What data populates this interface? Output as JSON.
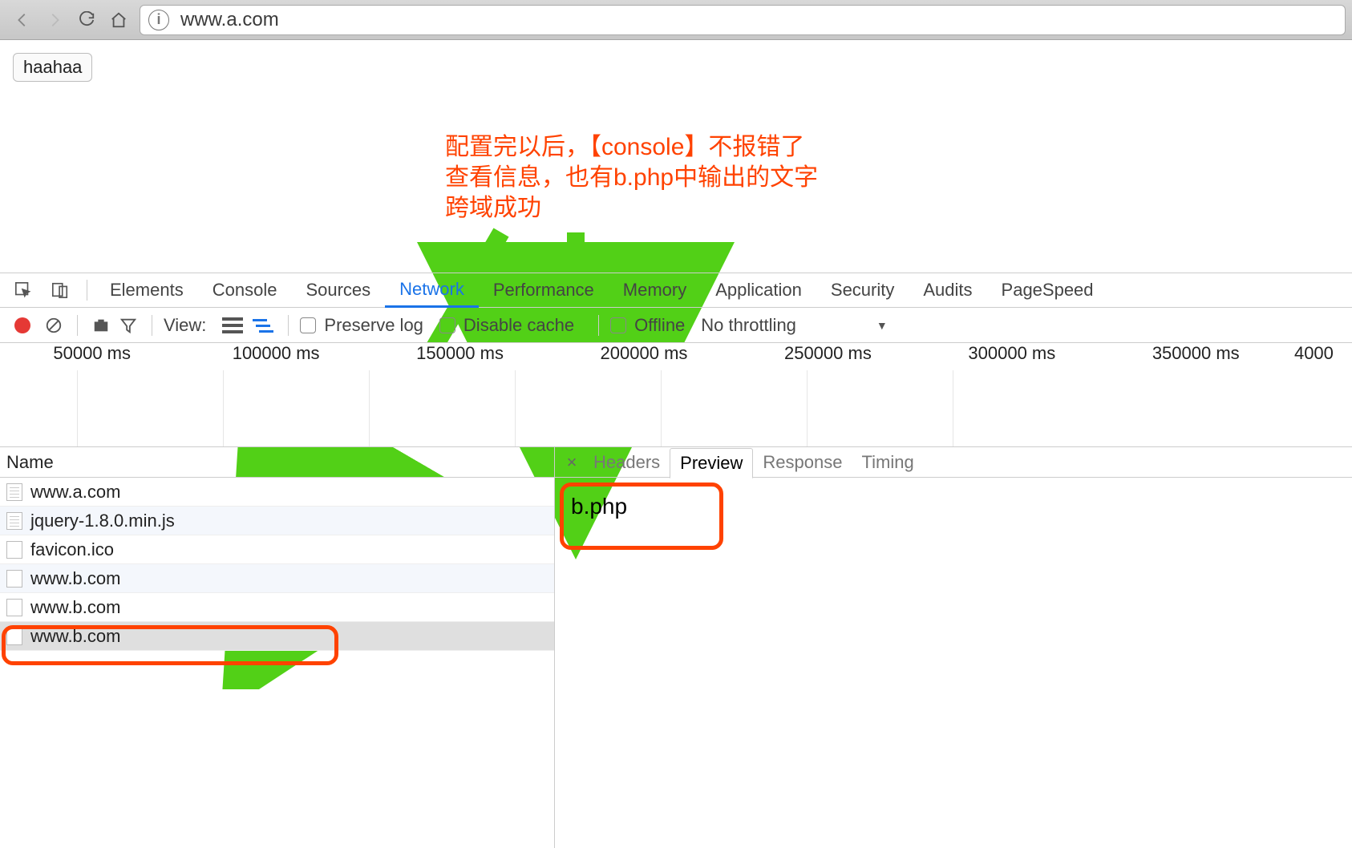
{
  "browser": {
    "url": "www.a.com",
    "info_icon_label": "i"
  },
  "page": {
    "button_label": "haahaa"
  },
  "annotation": {
    "line1": "配置完以后，【console】不报错了",
    "line2": "查看信息，也有b.php中输出的文字",
    "line3": "跨域成功"
  },
  "devtools": {
    "tabs": [
      "Elements",
      "Console",
      "Sources",
      "Network",
      "Performance",
      "Memory",
      "Application",
      "Security",
      "Audits",
      "PageSpeed"
    ],
    "active_tab_index": 3,
    "toolbar": {
      "view_label": "View:",
      "preserve_log": "Preserve log",
      "disable_cache": "Disable cache",
      "offline": "Offline",
      "throttling": "No throttling"
    },
    "timeline_ticks": [
      "50000 ms",
      "100000 ms",
      "150000 ms",
      "200000 ms",
      "250000 ms",
      "300000 ms",
      "350000 ms",
      "4000"
    ],
    "name_header": "Name",
    "requests": [
      {
        "name": "www.a.com",
        "type": "doc"
      },
      {
        "name": "jquery-1.8.0.min.js",
        "type": "doc"
      },
      {
        "name": "favicon.ico",
        "type": "blank"
      },
      {
        "name": "www.b.com",
        "type": "blank"
      },
      {
        "name": "www.b.com",
        "type": "blank"
      },
      {
        "name": "www.b.com",
        "type": "blank"
      }
    ],
    "selected_request_index": 5,
    "detail_tabs": [
      "Headers",
      "Preview",
      "Response",
      "Timing"
    ],
    "detail_active_index": 1,
    "preview_content": "b.php"
  }
}
